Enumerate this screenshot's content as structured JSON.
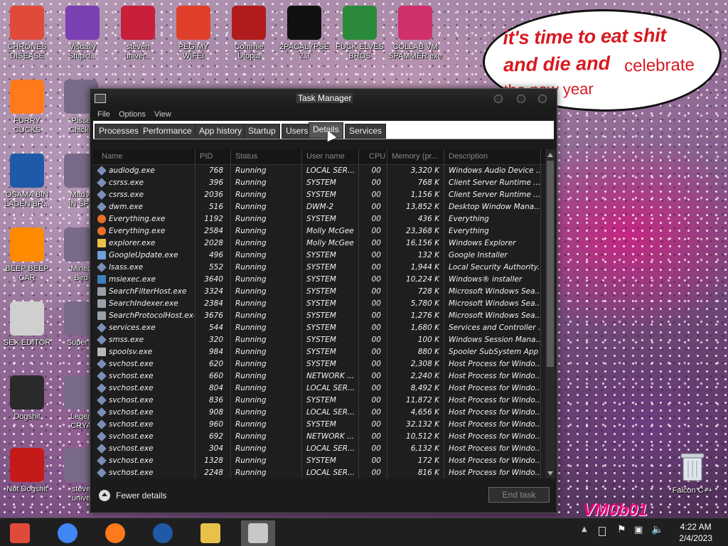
{
  "desktop": {
    "icons_left": [
      {
        "label": "CHRONES\nDISEASE",
        "icon": "chrome-icon",
        "color": "#e04a3a"
      },
      {
        "label": "FURRY CUCKS",
        "icon": "firefox-icon",
        "color": "#ff7a1a"
      },
      {
        "label": "OSAMA BIN\nLADEN BR...",
        "icon": "obama-logo-icon",
        "color": "#1e5aa8"
      },
      {
        "label": "BEEP BEEP\nCAR",
        "icon": "vlc-cone-icon",
        "color": "#ff8a00"
      },
      {
        "label": "SEX EDITOR",
        "icon": "hxd-icon",
        "color": "#cfcfcf"
      },
      {
        "label": "Dogshit",
        "icon": "dogshit-icon",
        "color": "#2a2a2a"
      },
      {
        "label": "Not Dogshit",
        "icon": "devcpp-icon",
        "color": "#c41a1a"
      }
    ],
    "icons_second": [
      {
        "label": "Pisse\nChicke",
        "icon": "chicken-icon"
      },
      {
        "label": "Mad A\nIN SPA",
        "icon": "game-icon"
      },
      {
        "label": "Minec\nBird",
        "icon": "angry-bird-icon"
      },
      {
        "label": "Super C",
        "icon": "super-icon"
      },
      {
        "label": "Legen\nCRYA",
        "icon": "pixel-hero-icon"
      },
      {
        "label": "steve\nunive",
        "icon": "gem-icon"
      }
    ],
    "icons_top": [
      {
        "label": "Visually\nStupid...",
        "icon": "visual-studio-icon",
        "color": "#7a3fb0"
      },
      {
        "label": "steven\nuniver...",
        "icon": "steven-icon",
        "color": "#c8203a"
      },
      {
        "label": "PEG MY WIFE!",
        "icon": "peggle-icon",
        "color": "#e0402a"
      },
      {
        "label": "Commie\nUtopia",
        "icon": "commie-icon",
        "color": "#b01c1c"
      },
      {
        "label": "2PACALYPSE\n2.3",
        "icon": "cmd-icon",
        "color": "#111111"
      },
      {
        "label": "FUCK ELVES\nBROS",
        "icon": "elf-icon",
        "color": "#2a8a3a"
      },
      {
        "label": "COLLAB VM\nSPAMMER.exe",
        "icon": "spammer-icon",
        "color": "#d0306a"
      }
    ],
    "recycle_bin": "Falcon C++",
    "bubble": {
      "line1": "it's time to eat shit",
      "line2": "and die and",
      "line2b": "celebrate",
      "line3": "the new year"
    },
    "watermark": "VM0b01"
  },
  "task_manager": {
    "title": "Task Manager",
    "menu": [
      "File",
      "Options",
      "View"
    ],
    "tabs": [
      "Processes",
      "Performance",
      "App history",
      "Startup",
      "Users",
      "Details",
      "Services"
    ],
    "active_tab": "Details",
    "columns": [
      "Name",
      "PID",
      "Status",
      "User name",
      "CPU",
      "Memory (pr...",
      "Description"
    ],
    "rows": [
      {
        "name": "audiodg.exe",
        "pid": "768",
        "status": "Running",
        "user": "LOCAL SER...",
        "cpu": "00",
        "mem": "3,320 K",
        "desc": "Windows Audio Device ...",
        "icon": "generic-exe"
      },
      {
        "name": "csrss.exe",
        "pid": "396",
        "status": "Running",
        "user": "SYSTEM",
        "cpu": "00",
        "mem": "768 K",
        "desc": "Client Server Runtime ...",
        "icon": "generic-exe"
      },
      {
        "name": "csrss.exe",
        "pid": "2036",
        "status": "Running",
        "user": "SYSTEM",
        "cpu": "00",
        "mem": "1,156 K",
        "desc": "Client Server Runtime ...",
        "icon": "generic-exe"
      },
      {
        "name": "dwm.exe",
        "pid": "516",
        "status": "Running",
        "user": "DWM-2",
        "cpu": "00",
        "mem": "13,852 K",
        "desc": "Desktop Window Mana...",
        "icon": "generic-exe"
      },
      {
        "name": "Everything.exe",
        "pid": "1192",
        "status": "Running",
        "user": "SYSTEM",
        "cpu": "00",
        "mem": "436 K",
        "desc": "Everything",
        "icon": "search-app"
      },
      {
        "name": "Everything.exe",
        "pid": "2584",
        "status": "Running",
        "user": "Molly McGee",
        "cpu": "00",
        "mem": "23,368 K",
        "desc": "Everything",
        "icon": "search-app"
      },
      {
        "name": "explorer.exe",
        "pid": "2028",
        "status": "Running",
        "user": "Molly McGee",
        "cpu": "00",
        "mem": "16,156 K",
        "desc": "Windows Explorer",
        "icon": "folder-app"
      },
      {
        "name": "GoogleUpdate.exe",
        "pid": "496",
        "status": "Running",
        "user": "SYSTEM",
        "cpu": "00",
        "mem": "132 K",
        "desc": "Google Installer",
        "icon": "window-app"
      },
      {
        "name": "lsass.exe",
        "pid": "552",
        "status": "Running",
        "user": "SYSTEM",
        "cpu": "00",
        "mem": "1,944 K",
        "desc": "Local Security Authority...",
        "icon": "generic-exe"
      },
      {
        "name": "msiexec.exe",
        "pid": "3640",
        "status": "Running",
        "user": "SYSTEM",
        "cpu": "00",
        "mem": "10,224 K",
        "desc": "Windows® installer",
        "icon": "installer-app"
      },
      {
        "name": "SearchFilterHost.exe",
        "pid": "3324",
        "status": "Running",
        "user": "SYSTEM",
        "cpu": "00",
        "mem": "728 K",
        "desc": "Microsoft Windows Sea...",
        "icon": "search-host"
      },
      {
        "name": "SearchIndexer.exe",
        "pid": "2384",
        "status": "Running",
        "user": "SYSTEM",
        "cpu": "00",
        "mem": "5,780 K",
        "desc": "Microsoft Windows Sea...",
        "icon": "search-host"
      },
      {
        "name": "SearchProtocolHost.exe",
        "pid": "3676",
        "status": "Running",
        "user": "SYSTEM",
        "cpu": "00",
        "mem": "1,276 K",
        "desc": "Microsoft Windows Sea...",
        "icon": "search-host"
      },
      {
        "name": "services.exe",
        "pid": "544",
        "status": "Running",
        "user": "SYSTEM",
        "cpu": "00",
        "mem": "1,680 K",
        "desc": "Services and Controller ...",
        "icon": "generic-exe"
      },
      {
        "name": "smss.exe",
        "pid": "320",
        "status": "Running",
        "user": "SYSTEM",
        "cpu": "00",
        "mem": "100 K",
        "desc": "Windows Session Mana...",
        "icon": "generic-exe"
      },
      {
        "name": "spoolsv.exe",
        "pid": "984",
        "status": "Running",
        "user": "SYSTEM",
        "cpu": "00",
        "mem": "880 K",
        "desc": "Spooler SubSystem App",
        "icon": "printer-app"
      },
      {
        "name": "svchost.exe",
        "pid": "620",
        "status": "Running",
        "user": "SYSTEM",
        "cpu": "00",
        "mem": "2,308 K",
        "desc": "Host Process for Windo...",
        "icon": "generic-exe"
      },
      {
        "name": "svchost.exe",
        "pid": "660",
        "status": "Running",
        "user": "NETWORK ...",
        "cpu": "00",
        "mem": "2,240 K",
        "desc": "Host Process for Windo...",
        "icon": "generic-exe"
      },
      {
        "name": "svchost.exe",
        "pid": "804",
        "status": "Running",
        "user": "LOCAL SER...",
        "cpu": "00",
        "mem": "8,492 K",
        "desc": "Host Process for Windo...",
        "icon": "generic-exe"
      },
      {
        "name": "svchost.exe",
        "pid": "836",
        "status": "Running",
        "user": "SYSTEM",
        "cpu": "00",
        "mem": "11,872 K",
        "desc": "Host Process for Windo...",
        "icon": "generic-exe"
      },
      {
        "name": "svchost.exe",
        "pid": "908",
        "status": "Running",
        "user": "LOCAL SER...",
        "cpu": "00",
        "mem": "4,656 K",
        "desc": "Host Process for Windo...",
        "icon": "generic-exe"
      },
      {
        "name": "svchost.exe",
        "pid": "960",
        "status": "Running",
        "user": "SYSTEM",
        "cpu": "00",
        "mem": "32,132 K",
        "desc": "Host Process for Windo...",
        "icon": "generic-exe"
      },
      {
        "name": "svchost.exe",
        "pid": "692",
        "status": "Running",
        "user": "NETWORK ...",
        "cpu": "00",
        "mem": "10,512 K",
        "desc": "Host Process for Windo...",
        "icon": "generic-exe"
      },
      {
        "name": "svchost.exe",
        "pid": "304",
        "status": "Running",
        "user": "LOCAL SER...",
        "cpu": "00",
        "mem": "6,132 K",
        "desc": "Host Process for Windo...",
        "icon": "generic-exe"
      },
      {
        "name": "svchost.exe",
        "pid": "1328",
        "status": "Running",
        "user": "SYSTEM",
        "cpu": "00",
        "mem": "172 K",
        "desc": "Host Process for Windo...",
        "icon": "generic-exe"
      },
      {
        "name": "svchost.exe",
        "pid": "2248",
        "status": "Running",
        "user": "LOCAL SER...",
        "cpu": "00",
        "mem": "816 K",
        "desc": "Host Process for Windo...",
        "icon": "generic-exe"
      }
    ],
    "fewer_details": "Fewer details",
    "end_task": "End task"
  },
  "taskbar": {
    "pinned": [
      "explorer-icon",
      "chrome-icon",
      "firefox-icon",
      "obama-logo-icon",
      "folder-icon",
      "task-manager-icon"
    ],
    "tray": [
      "chevron-up-icon",
      "desktop-icon",
      "flag-icon",
      "network-icon",
      "volume-icon"
    ],
    "time": "4:22 AM",
    "date": "2/4/2023"
  }
}
